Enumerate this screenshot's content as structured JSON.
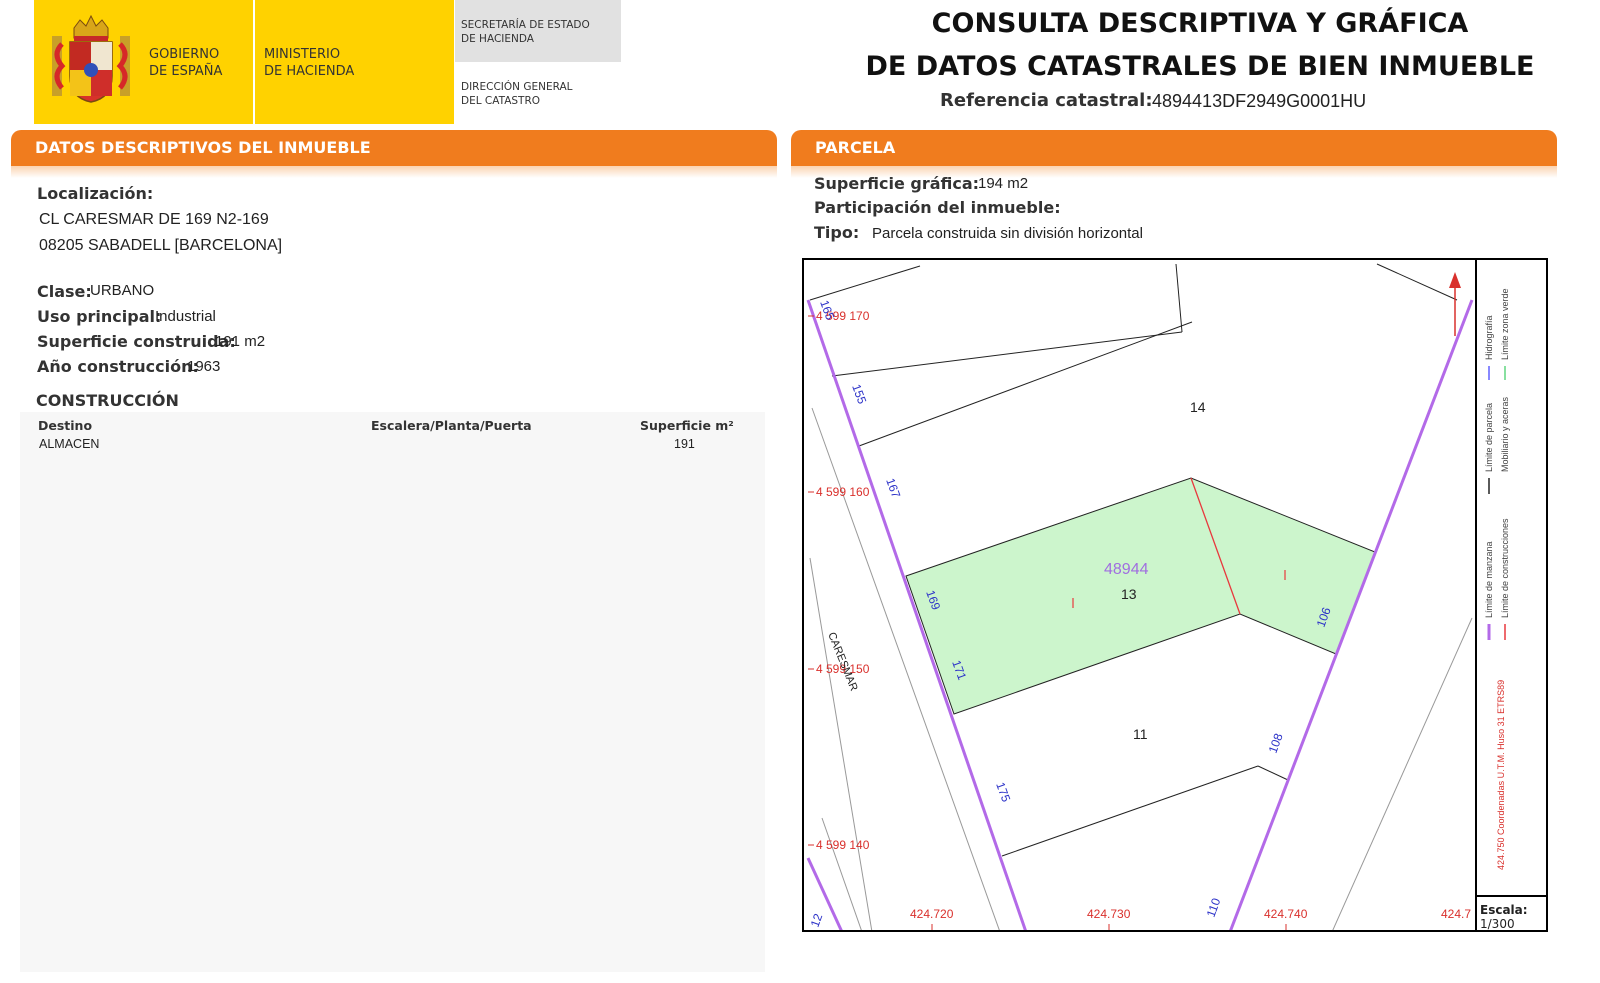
{
  "header": {
    "gov_line1": "GOBIERNO",
    "gov_line2": "DE ESPAÑA",
    "ministry_line1": "MINISTERIO",
    "ministry_line2": "DE HACIENDA",
    "secretaria_line1": "SECRETARÍA DE ESTADO",
    "secretaria_line2": "DE HACIENDA",
    "direccion_line1": "DIRECCIÓN GENERAL",
    "direccion_line2": "DEL CATASTRO",
    "title_line1": "CONSULTA DESCRIPTIVA Y GRÁFICA",
    "title_line2": "DE DATOS CATASTRALES DE BIEN INMUEBLE",
    "ref_label": "Referencia catastral:",
    "ref_value": "4894413DF2949G0001HU"
  },
  "descriptivos": {
    "section_title": "DATOS DESCRIPTIVOS DEL INMUEBLE",
    "localizacion_label": "Localización:",
    "address_line1": "CL CARESMAR DE 169 N2-169",
    "address_line2": "08205 SABADELL [BARCELONA]",
    "clase_label": "Clase:",
    "clase_value": "URBANO",
    "uso_label": "Uso principal:",
    "uso_value": "Industrial",
    "superficie_label": "Superficie construida:",
    "superficie_value": "191 m2",
    "anio_label": "Año construcción:",
    "anio_value": "1963",
    "construccion_title": "CONSTRUCCIÓN",
    "table": {
      "headers": [
        "Destino",
        "Escalera/Planta/Puerta",
        "Superficie m²"
      ],
      "rows": [
        [
          "ALMACEN",
          "",
          "191"
        ]
      ]
    }
  },
  "parcela": {
    "section_title": "PARCELA",
    "superficie_label": "Superficie gráfica:",
    "superficie_value": "194 m2",
    "participacion_label": "Participación del inmueble:",
    "tipo_label": "Tipo:",
    "tipo_value": "Parcela construida sin división horizontal"
  },
  "map": {
    "parcel_id": "48944",
    "parcel_numbers": [
      "14",
      "13",
      "11"
    ],
    "northing_labels": [
      "4 599 170",
      "4 599 160",
      "4 599 150",
      "4 599 140"
    ],
    "easting_labels": [
      "424.720",
      "424.730",
      "424.740",
      "424.7"
    ],
    "street_numbers": [
      "165",
      "155",
      "167",
      "169",
      "171",
      "175",
      "106",
      "108",
      "110",
      "12"
    ],
    "street_name": "CARESMAR",
    "legend": {
      "hidrografia": "Hidrografía",
      "limite_zona_verde": "Límite zona verde",
      "limite_parcela": "Límite de parcela",
      "mobiliario": "Mobiliario y aceras",
      "limite_manzana": "Límite de manzana",
      "limite_construcciones": "Límite de construcciones",
      "coordenadas": "424.750 Coordenadas U.T.M. Huso 31 ETRS89"
    },
    "escala_label": "Escala:",
    "escala_value": "1/300",
    "colors": {
      "parcel_fill": "#ccf5cc",
      "manzana_line": "#b36ae8",
      "construction_line": "#e8383d",
      "coord_text": "#d9302c",
      "number_text": "#2c32c8",
      "hidrografia": "#8888ff",
      "zona_verde": "#88e0a0"
    }
  }
}
